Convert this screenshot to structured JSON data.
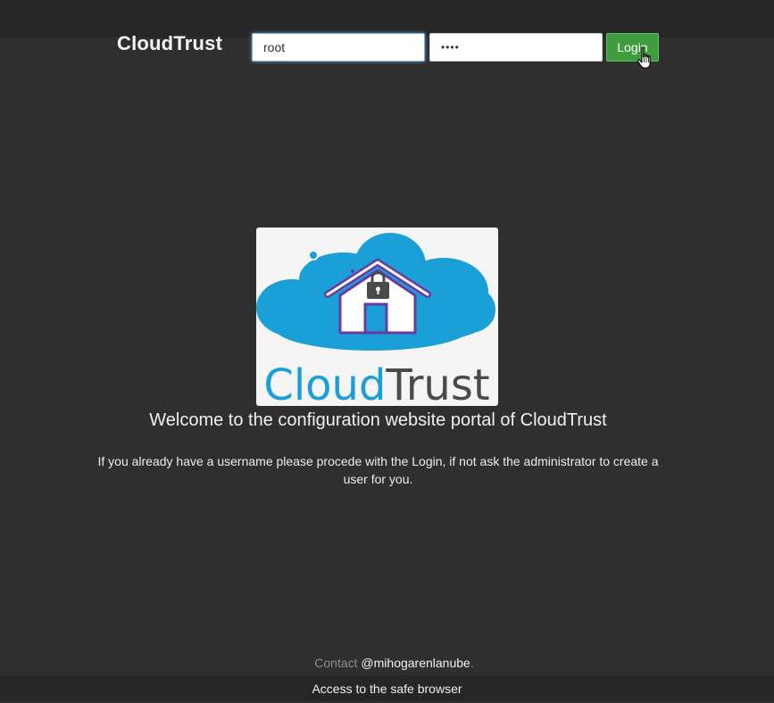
{
  "header": {
    "brand": "CloudTrust",
    "username_value": "root",
    "password_value": "••••",
    "login_label": "Login"
  },
  "logo": {
    "word_primary": "Cloud",
    "word_secondary": "Trust",
    "colors": {
      "cloud": "#1a9fd6",
      "house_outline": "#6b3aa0",
      "lock": "#4a4a4a",
      "text_secondary": "#4a4a4a"
    }
  },
  "main": {
    "welcome": "Welcome to the configuration website portal of CloudTrust",
    "info": "If you already have a username please procede with the Login, if not ask the administrator to create a user for you."
  },
  "footer": {
    "contact_prefix": "Contact",
    "contact_handle": "@mihogarenlanube",
    "contact_suffix": ".",
    "safe_browser_link": "Access to the safe browser"
  },
  "colors": {
    "background": "#2f2f2f",
    "bar": "#262626",
    "login_button": "#3f9d3f"
  }
}
